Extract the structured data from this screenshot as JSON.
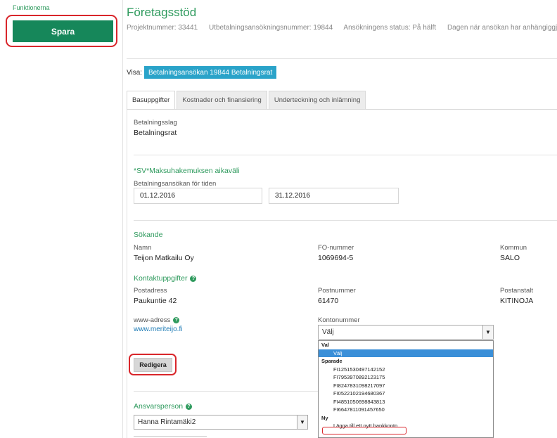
{
  "sidebar": {
    "section_label": "Funktionerna",
    "save_label": "Spara"
  },
  "header": {
    "title": "Företagsstöd",
    "meta": [
      "Projektnummer: 33441",
      "Utbetalningsansökningsnummer: 19844",
      "Ansökningens status: På hälft",
      "Dagen när ansökan har anhängiggjorts:"
    ]
  },
  "visa": {
    "label": "Visa:",
    "selected": "Betalningsansökan 19844 Betalningsrat"
  },
  "tabs": [
    {
      "label": "Basuppgifter",
      "active": true
    },
    {
      "label": "Kostnader och finansiering",
      "active": false
    },
    {
      "label": "Underteckning och inlämning",
      "active": false
    }
  ],
  "payment": {
    "type_label": "Betalningsslag",
    "type_value": "Betalningsrat"
  },
  "period": {
    "section_title": "*SV*Maksuhakemuksen aikaväli",
    "label": "Betalningsansökan för tiden",
    "start": "01.12.2016",
    "end": "31.12.2016"
  },
  "applicant": {
    "section_title": "Sökande",
    "name_label": "Namn",
    "name_value": "Teijon Matkailu Oy",
    "fo_label": "FO-nummer",
    "fo_value": "1069694-5",
    "kommun_label": "Kommun",
    "kommun_value": "SALO"
  },
  "contact": {
    "section_title": "Kontaktuppgifter",
    "address_label": "Postadress",
    "address_value": "Paukuntie 42",
    "postnr_label": "Postnummer",
    "postnr_value": "61470",
    "postanstalt_label": "Postanstalt",
    "postanstalt_value": "KITINOJA",
    "www_label": "www-adress",
    "www_value": "www.meriteijo.fi",
    "konto_label": "Kontonummer",
    "konto_selected": "Välj"
  },
  "edit_button": "Redigera",
  "dropdown": {
    "group_val": "Val",
    "option_valj": "Välj",
    "group_saved": "Sparade",
    "accounts": [
      "FI1251530497142152",
      "FI7953970892123175",
      "FI8247831098217097",
      "FI0522102194680367",
      "FI4851050698843813",
      "FI6647811091457650"
    ],
    "group_new": "Ny",
    "add_new": "Lägga till ett nytt bankkonto"
  },
  "responsible": {
    "section_title": "Ansvarsperson",
    "selected": "Hanna Rintamäki2"
  },
  "colors": {
    "accent_green": "#2e9a5d",
    "button_green": "#16875a",
    "pill_blue": "#2aa3c9",
    "highlight_red": "#d9262b"
  }
}
